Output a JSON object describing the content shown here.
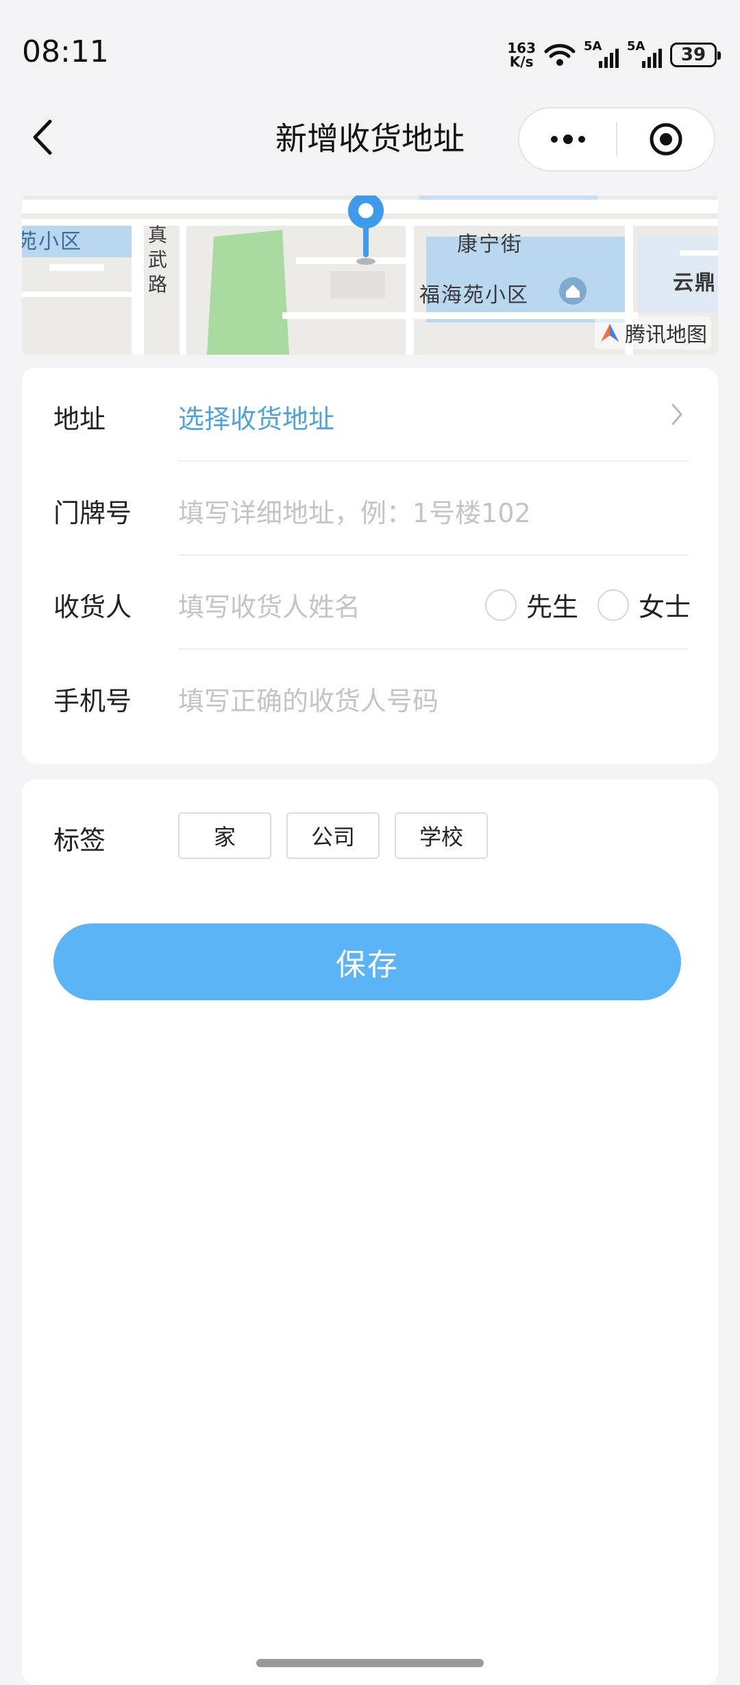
{
  "status_bar": {
    "time": "08:11",
    "net_speed_value": "163",
    "net_speed_unit": "K/s",
    "sim1_label": "5A",
    "sim2_label": "5A",
    "battery": "39"
  },
  "nav": {
    "title": "新增收货地址"
  },
  "map": {
    "labels": {
      "left_area": "苑小区",
      "road_vertical": "真武路",
      "street": "康宁街",
      "community": "福海苑小区",
      "right_edge": "云鼎"
    },
    "provider": "腾讯地图",
    "colors": {
      "water": "#b9d7ee",
      "park": "#a9dba0",
      "road": "#ffffff",
      "pin": "#3d9be9"
    }
  },
  "form": {
    "address": {
      "label": "地址",
      "value": "选择收货地址"
    },
    "door": {
      "label": "门牌号",
      "placeholder": "填写详细地址，例：1号楼102"
    },
    "receiver": {
      "label": "收货人",
      "placeholder": "填写收货人姓名",
      "options": [
        "先生",
        "女士"
      ]
    },
    "phone": {
      "label": "手机号",
      "placeholder": "填写正确的收货人号码"
    }
  },
  "tags": {
    "label": "标签",
    "options": [
      "家",
      "公司",
      "学校"
    ]
  },
  "save_button": "保存",
  "colors": {
    "accent": "#5ab4f6",
    "link": "#4fa3dc",
    "placeholder": "#c4c4c4"
  }
}
